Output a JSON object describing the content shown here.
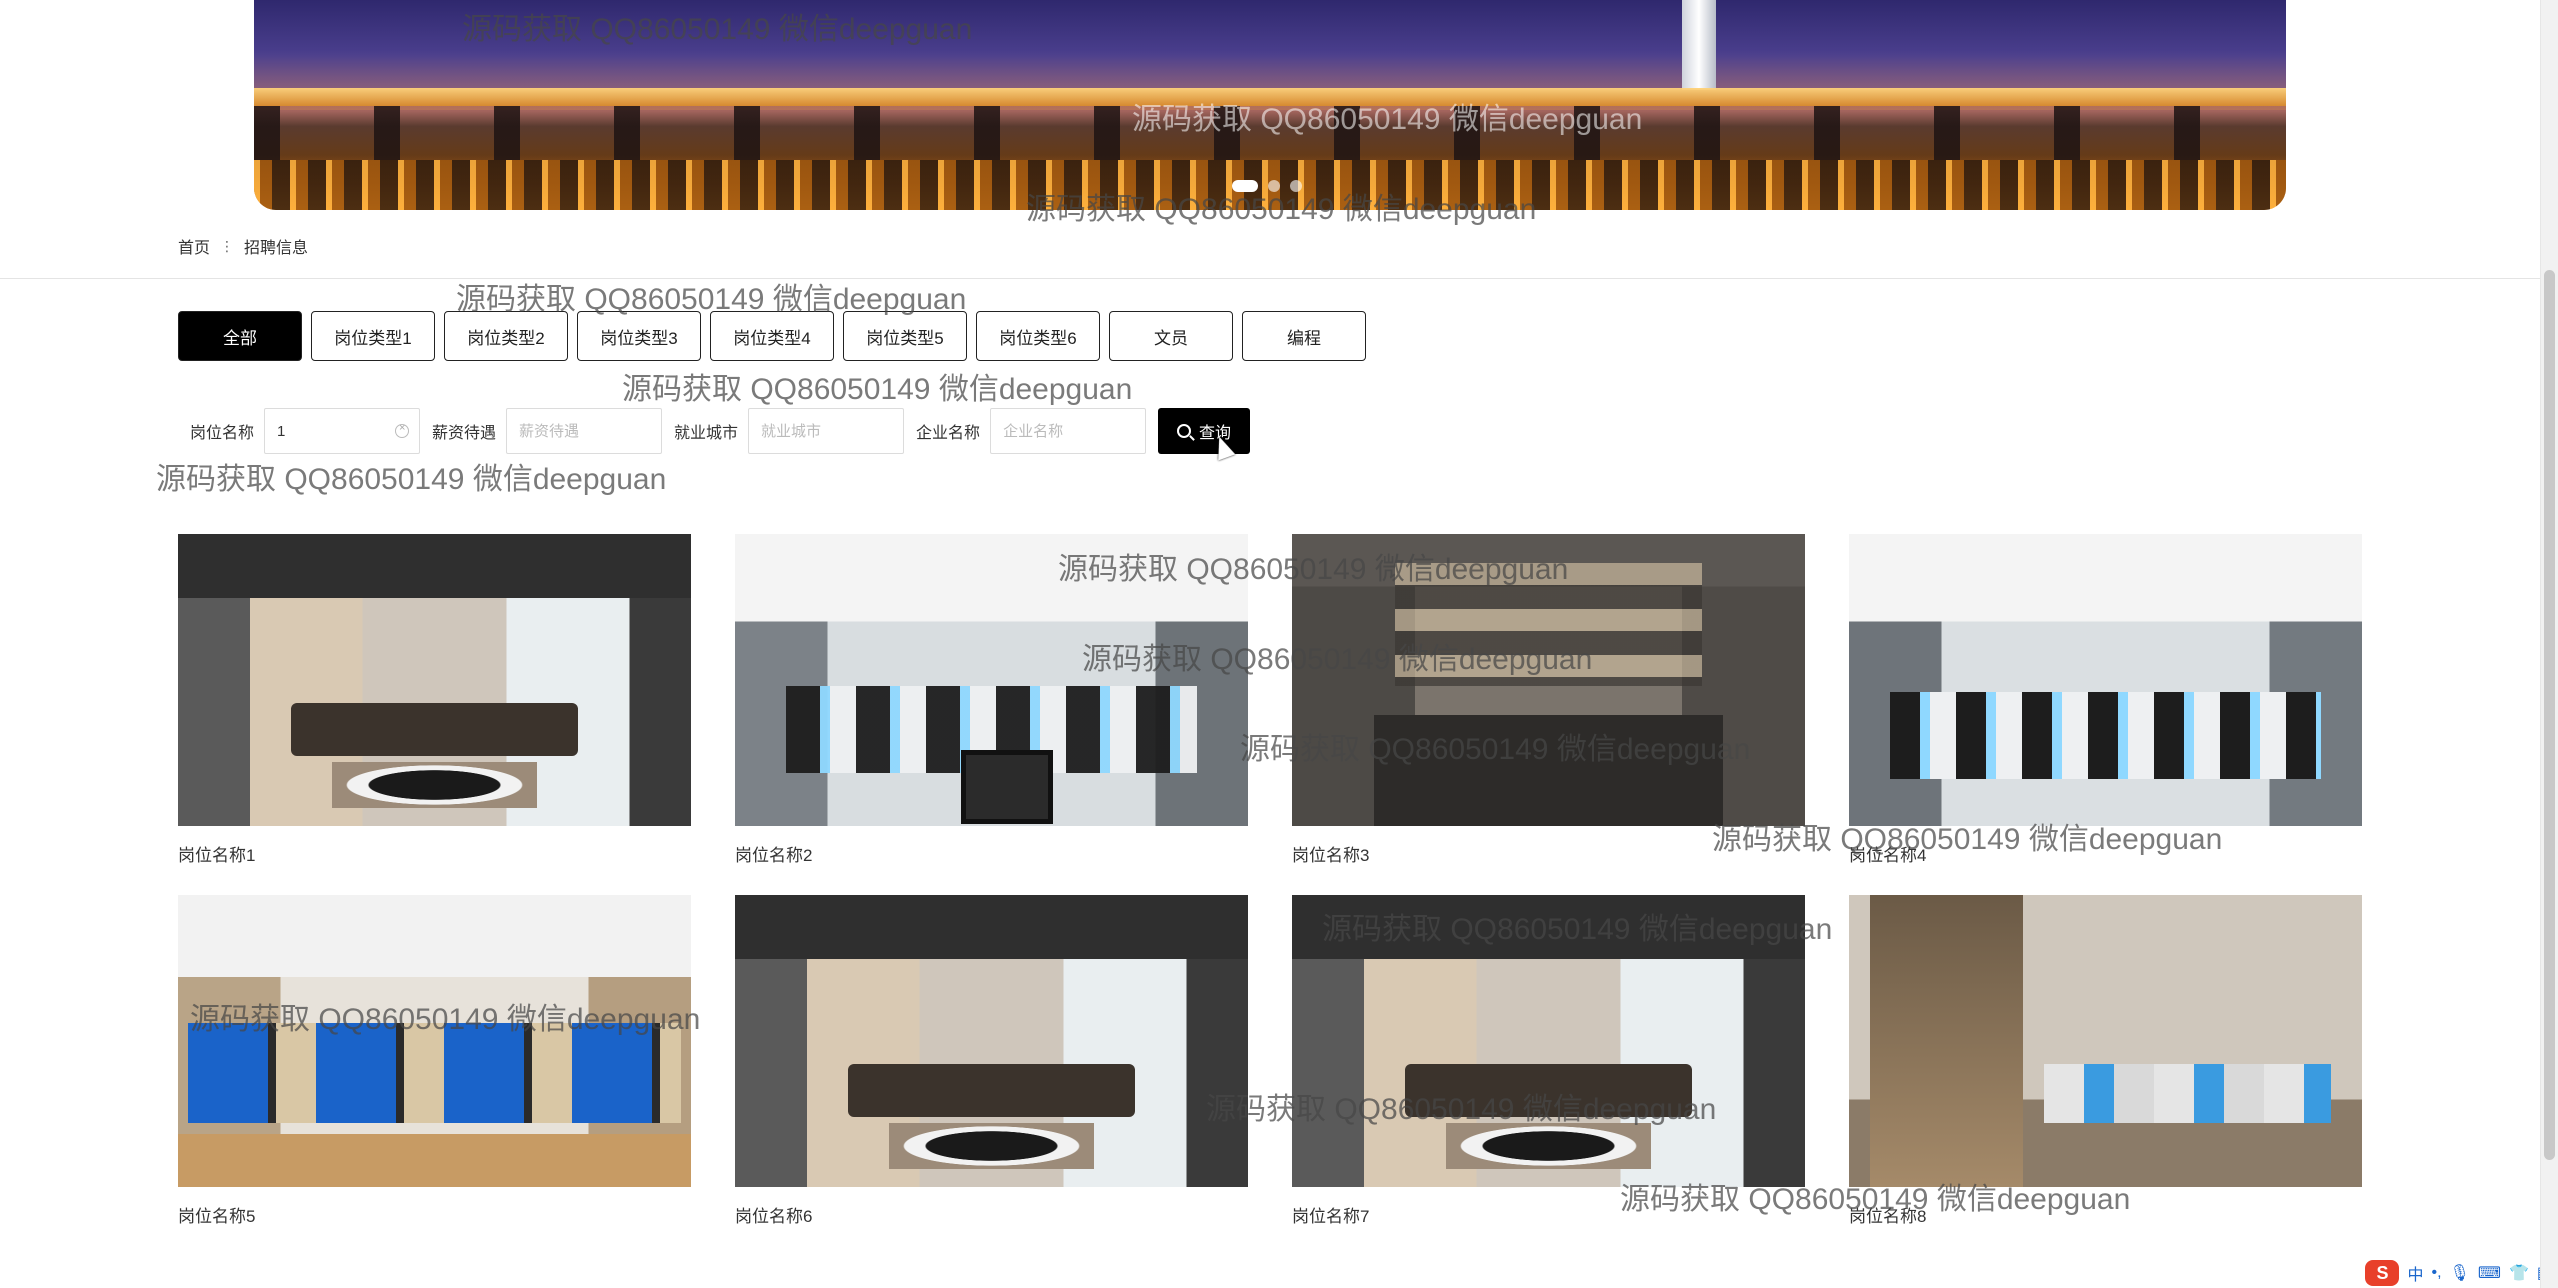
{
  "banner": {
    "slide_count": 3,
    "active_slide": 1
  },
  "breadcrumb": {
    "home": "首页",
    "separator": "⋮",
    "current": "招聘信息"
  },
  "tabs": [
    "全部",
    "岗位类型1",
    "岗位类型2",
    "岗位类型3",
    "岗位类型4",
    "岗位类型5",
    "岗位类型6",
    "文员",
    "编程"
  ],
  "active_tab": "全部",
  "search": {
    "position_label": "岗位名称",
    "position_value": "1",
    "salary_label": "薪资待遇",
    "salary_placeholder": "薪资待遇",
    "city_label": "就业城市",
    "city_placeholder": "就业城市",
    "company_label": "企业名称",
    "company_placeholder": "企业名称",
    "query_label": "查询"
  },
  "jobs": [
    {
      "title": "岗位名称1",
      "thumb_style": "office-a"
    },
    {
      "title": "岗位名称2",
      "thumb_style": "office-b"
    },
    {
      "title": "岗位名称3",
      "thumb_style": "office-c"
    },
    {
      "title": "岗位名称4",
      "thumb_style": "office-d"
    },
    {
      "title": "岗位名称5",
      "thumb_style": "office-e"
    },
    {
      "title": "岗位名称6",
      "thumb_style": "office-a"
    },
    {
      "title": "岗位名称7",
      "thumb_style": "office-a"
    },
    {
      "title": "岗位名称8",
      "thumb_style": "office-f"
    }
  ],
  "watermark": "源码获取 QQ86050149 微信deepguan",
  "tray": {
    "ime": "S",
    "lang": "中"
  }
}
